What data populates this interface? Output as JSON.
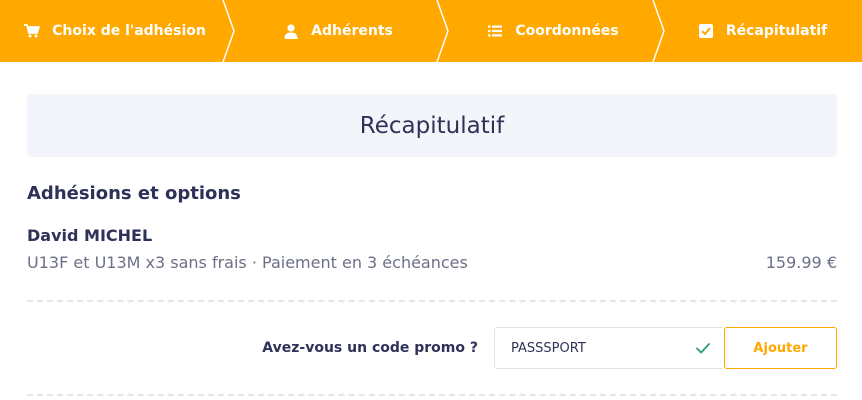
{
  "steps": [
    {
      "label": "Choix de l'adhésion",
      "icon": "cart-icon"
    },
    {
      "label": "Adhérents",
      "icon": "user-icon"
    },
    {
      "label": "Coordonnées",
      "icon": "list-icon"
    },
    {
      "label": "Récapitulatif",
      "icon": "checkbox-icon",
      "active": true
    }
  ],
  "summary": {
    "title": "Récapitulatif",
    "section_title": "Adhésions et options",
    "member": {
      "name": "David MICHEL",
      "description": "U13F et U13M x3 sans frais · Paiement en 3 échéances",
      "price": "159.99 €"
    }
  },
  "promo": {
    "label": "Avez-vous un code promo ?",
    "value": "PASSSPORT",
    "valid": true,
    "button_label": "Ajouter"
  },
  "colors": {
    "accent": "#ffa800",
    "text_dark": "#2e3158",
    "text_muted": "#6c7086",
    "title_bg": "#f4f5fa",
    "success": "#2e9e6a"
  }
}
